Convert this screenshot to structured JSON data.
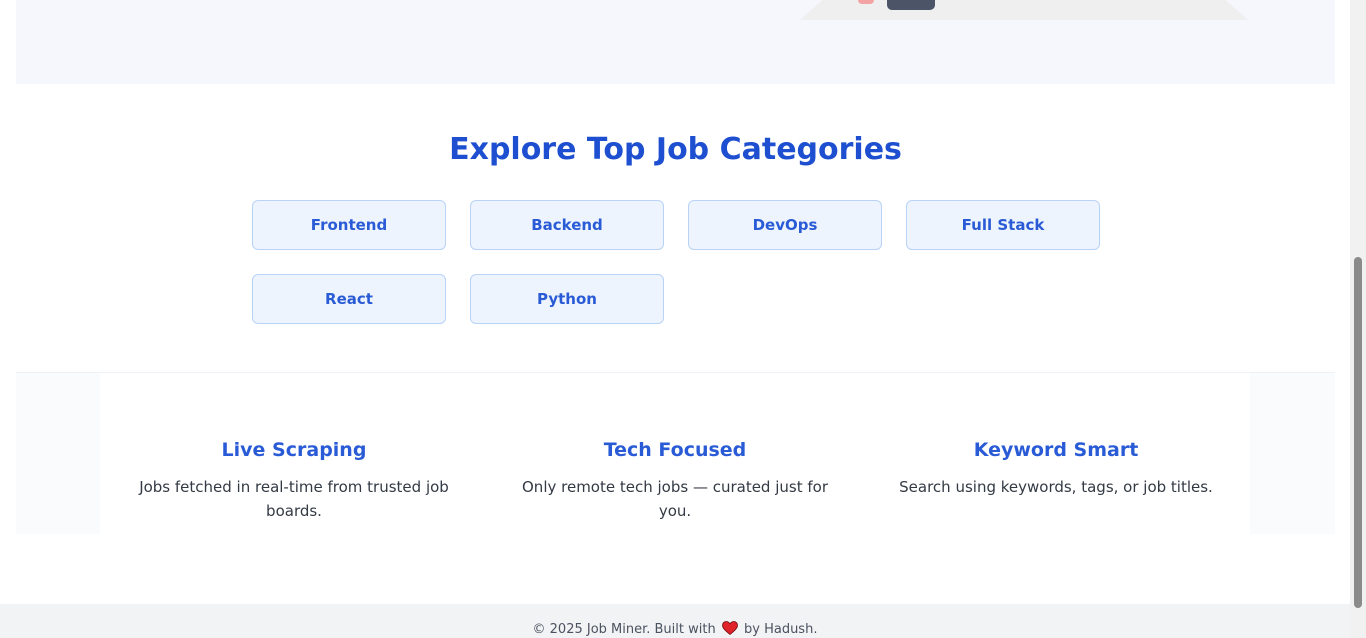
{
  "categories": {
    "title": "Explore Top Job Categories",
    "items": [
      "Frontend",
      "Backend",
      "DevOps",
      "Full Stack",
      "React",
      "Python"
    ]
  },
  "features": [
    {
      "title": "Live Scraping",
      "text": "Jobs fetched in real-time from trusted job boards."
    },
    {
      "title": "Tech Focused",
      "text": "Only remote tech jobs — curated just for you."
    },
    {
      "title": "Keyword Smart",
      "text": "Search using keywords, tags, or job titles."
    }
  ],
  "footer": {
    "before": "© 2025 Job Miner. Built with",
    "after": "by Hadush."
  },
  "colors": {
    "accent": "#1d4fd0",
    "heart": "#e0222a"
  },
  "icons": {
    "heart": "heart-icon"
  }
}
